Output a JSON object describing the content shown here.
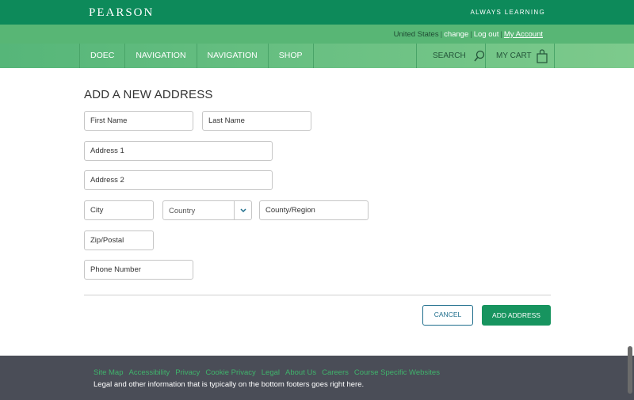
{
  "header": {
    "logo": "PEARSON",
    "tagline": "ALWAYS LEARNING"
  },
  "utility": {
    "region": "United States",
    "change": "change",
    "logout": "Log out",
    "account": "My Account"
  },
  "nav": {
    "items": [
      "DOEC",
      "NAVIGATION",
      "NAVIGATION",
      "SHOP"
    ],
    "search": "SEARCH",
    "cart": "MY CART"
  },
  "form": {
    "title": "ADD A NEW ADDRESS",
    "first_name": "First Name",
    "last_name": "Last Name",
    "address1": "Address 1",
    "address2": "Address 2",
    "city": "City",
    "country": "Country",
    "county": "County/Region",
    "zip": "Zip/Postal",
    "phone": "Phone Number",
    "cancel": "CANCEL",
    "add": "ADD ADDRESS"
  },
  "footer": {
    "links": [
      "Site Map",
      "Accessibility",
      "Privacy",
      "Cookie Privacy",
      "Legal",
      "About Us",
      "Careers",
      "Course Specific Websites"
    ],
    "text": "Legal and other information that is typically on the bottom footers goes right here."
  },
  "colors": {
    "brand_green": "#0d8a5a",
    "button_green": "#17945f",
    "footer_bg": "#4a4d57",
    "link_green": "#3fb36b",
    "cancel_blue": "#1f6e8c"
  }
}
